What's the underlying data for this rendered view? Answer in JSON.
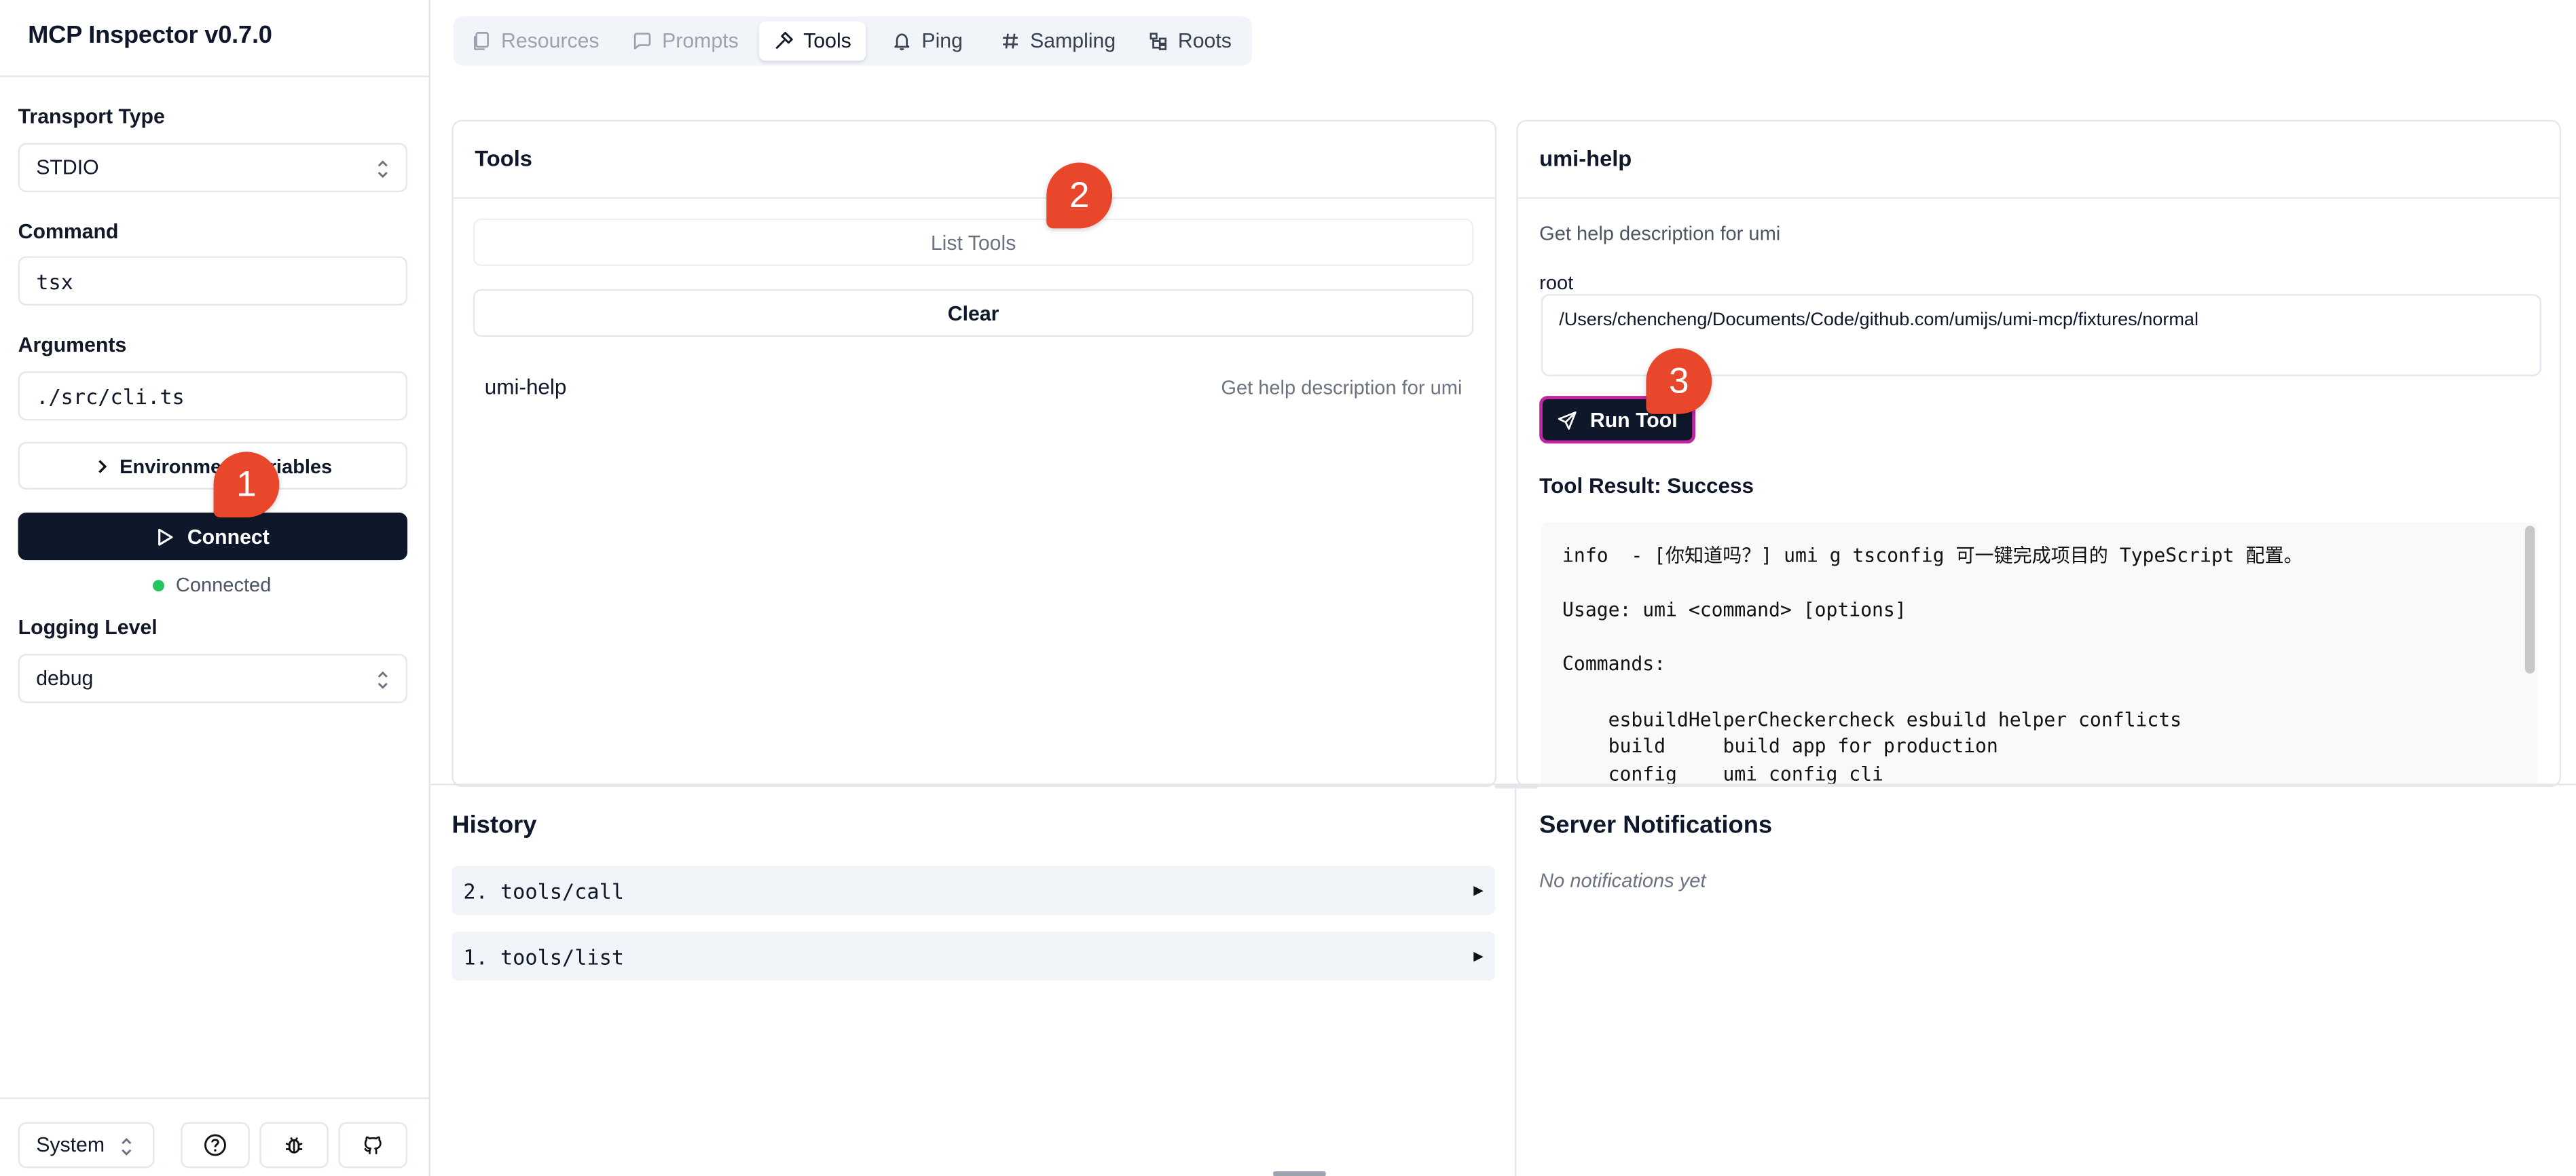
{
  "app": {
    "title": "MCP Inspector v0.7.0"
  },
  "sidebar": {
    "transport_label": "Transport Type",
    "transport_value": "STDIO",
    "command_label": "Command",
    "command_value": "tsx",
    "arguments_label": "Arguments",
    "arguments_value": "./src/cli.ts",
    "env_button": "Environment Variables",
    "connect_button": "Connect",
    "status": "Connected",
    "logging_label": "Logging Level",
    "logging_value": "debug",
    "theme_value": "System"
  },
  "tabs": [
    {
      "label": "Resources",
      "state": "disabled"
    },
    {
      "label": "Prompts",
      "state": "disabled"
    },
    {
      "label": "Tools",
      "state": "active"
    },
    {
      "label": "Ping",
      "state": "normal"
    },
    {
      "label": "Sampling",
      "state": "normal"
    },
    {
      "label": "Roots",
      "state": "normal"
    }
  ],
  "tools_panel": {
    "title": "Tools",
    "list_button": "List Tools",
    "clear_button": "Clear",
    "items": [
      {
        "name": "umi-help",
        "description": "Get help description for umi"
      }
    ]
  },
  "detail_panel": {
    "title": "umi-help",
    "description": "Get help description for umi",
    "param_label": "root",
    "param_value": "/Users/chencheng/Documents/Code/github.com/umijs/umi-mcp/fixtures/normal",
    "run_button": "Run Tool",
    "result_title": "Tool Result: Success",
    "result_lines": [
      "info  - [你知道吗？] umi g tsconfig 可一键完成项目的 TypeScript 配置。",
      "",
      "Usage: umi <command> [options]",
      "",
      "Commands:",
      "",
      "    esbuildHelperCheckercheck esbuild helper conflicts",
      "    build     build app for production",
      "    config    umi config cli"
    ]
  },
  "history": {
    "title": "History",
    "items": [
      "2. tools/call",
      "1. tools/list"
    ]
  },
  "notifications": {
    "title": "Server Notifications",
    "empty": "No notifications yet"
  },
  "annotations": [
    "1",
    "2",
    "3"
  ],
  "colors": {
    "primary": "#0f172a",
    "annotation": "#e8472b",
    "connected": "#22c55e",
    "run_border": "#c026a3"
  },
  "icons": {
    "play": "play-icon",
    "send": "send-icon",
    "chevron": "chevron-right-icon",
    "help": "help-circle-icon",
    "bug": "bug-icon",
    "github": "github-icon"
  }
}
